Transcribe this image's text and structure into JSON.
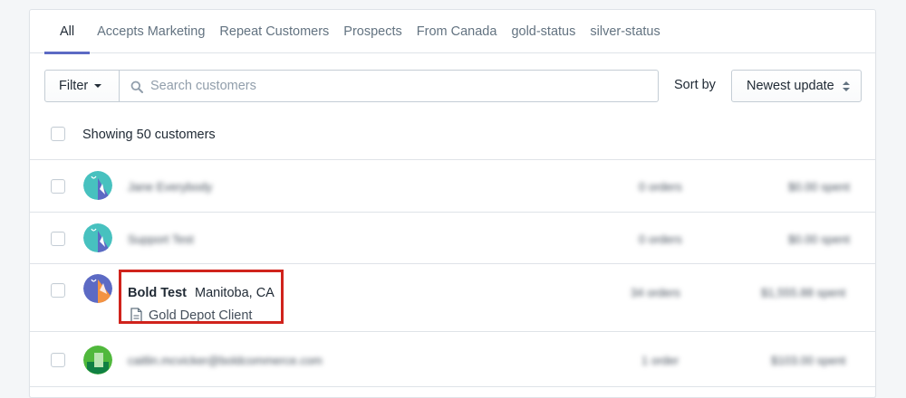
{
  "tabs": [
    {
      "label": "All",
      "active": true
    },
    {
      "label": "Accepts Marketing"
    },
    {
      "label": "Repeat Customers"
    },
    {
      "label": "Prospects"
    },
    {
      "label": "From Canada"
    },
    {
      "label": "gold-status"
    },
    {
      "label": "silver-status"
    }
  ],
  "toolbar": {
    "filter_label": "Filter",
    "search_placeholder": "Search customers",
    "sort_label": "Sort by",
    "sort_value": "Newest update"
  },
  "list": {
    "showing_text": "Showing 50 customers"
  },
  "customers": [
    {
      "name": "Jane Everybody",
      "orders": "0 orders",
      "spent": "$0.00 spent"
    },
    {
      "name": "Support Test",
      "orders": "0 orders",
      "spent": "$0.00 spent"
    },
    {
      "name": "Bold Test",
      "location": "Manitoba, CA",
      "note": "Gold Depot Client",
      "orders": "34 orders",
      "spent": "$1,555.88 spent"
    },
    {
      "name": "caitlin.mcvicker@boldcommerce.com",
      "orders": "1 order",
      "spent": "$103.00 spent"
    }
  ],
  "colors": {
    "accent": "#5c6ac4",
    "highlight": "#d0231c",
    "avatar_teal": "#47c1bf",
    "avatar_indigo": "#5c6ac4",
    "avatar_green": "#50b83c"
  }
}
